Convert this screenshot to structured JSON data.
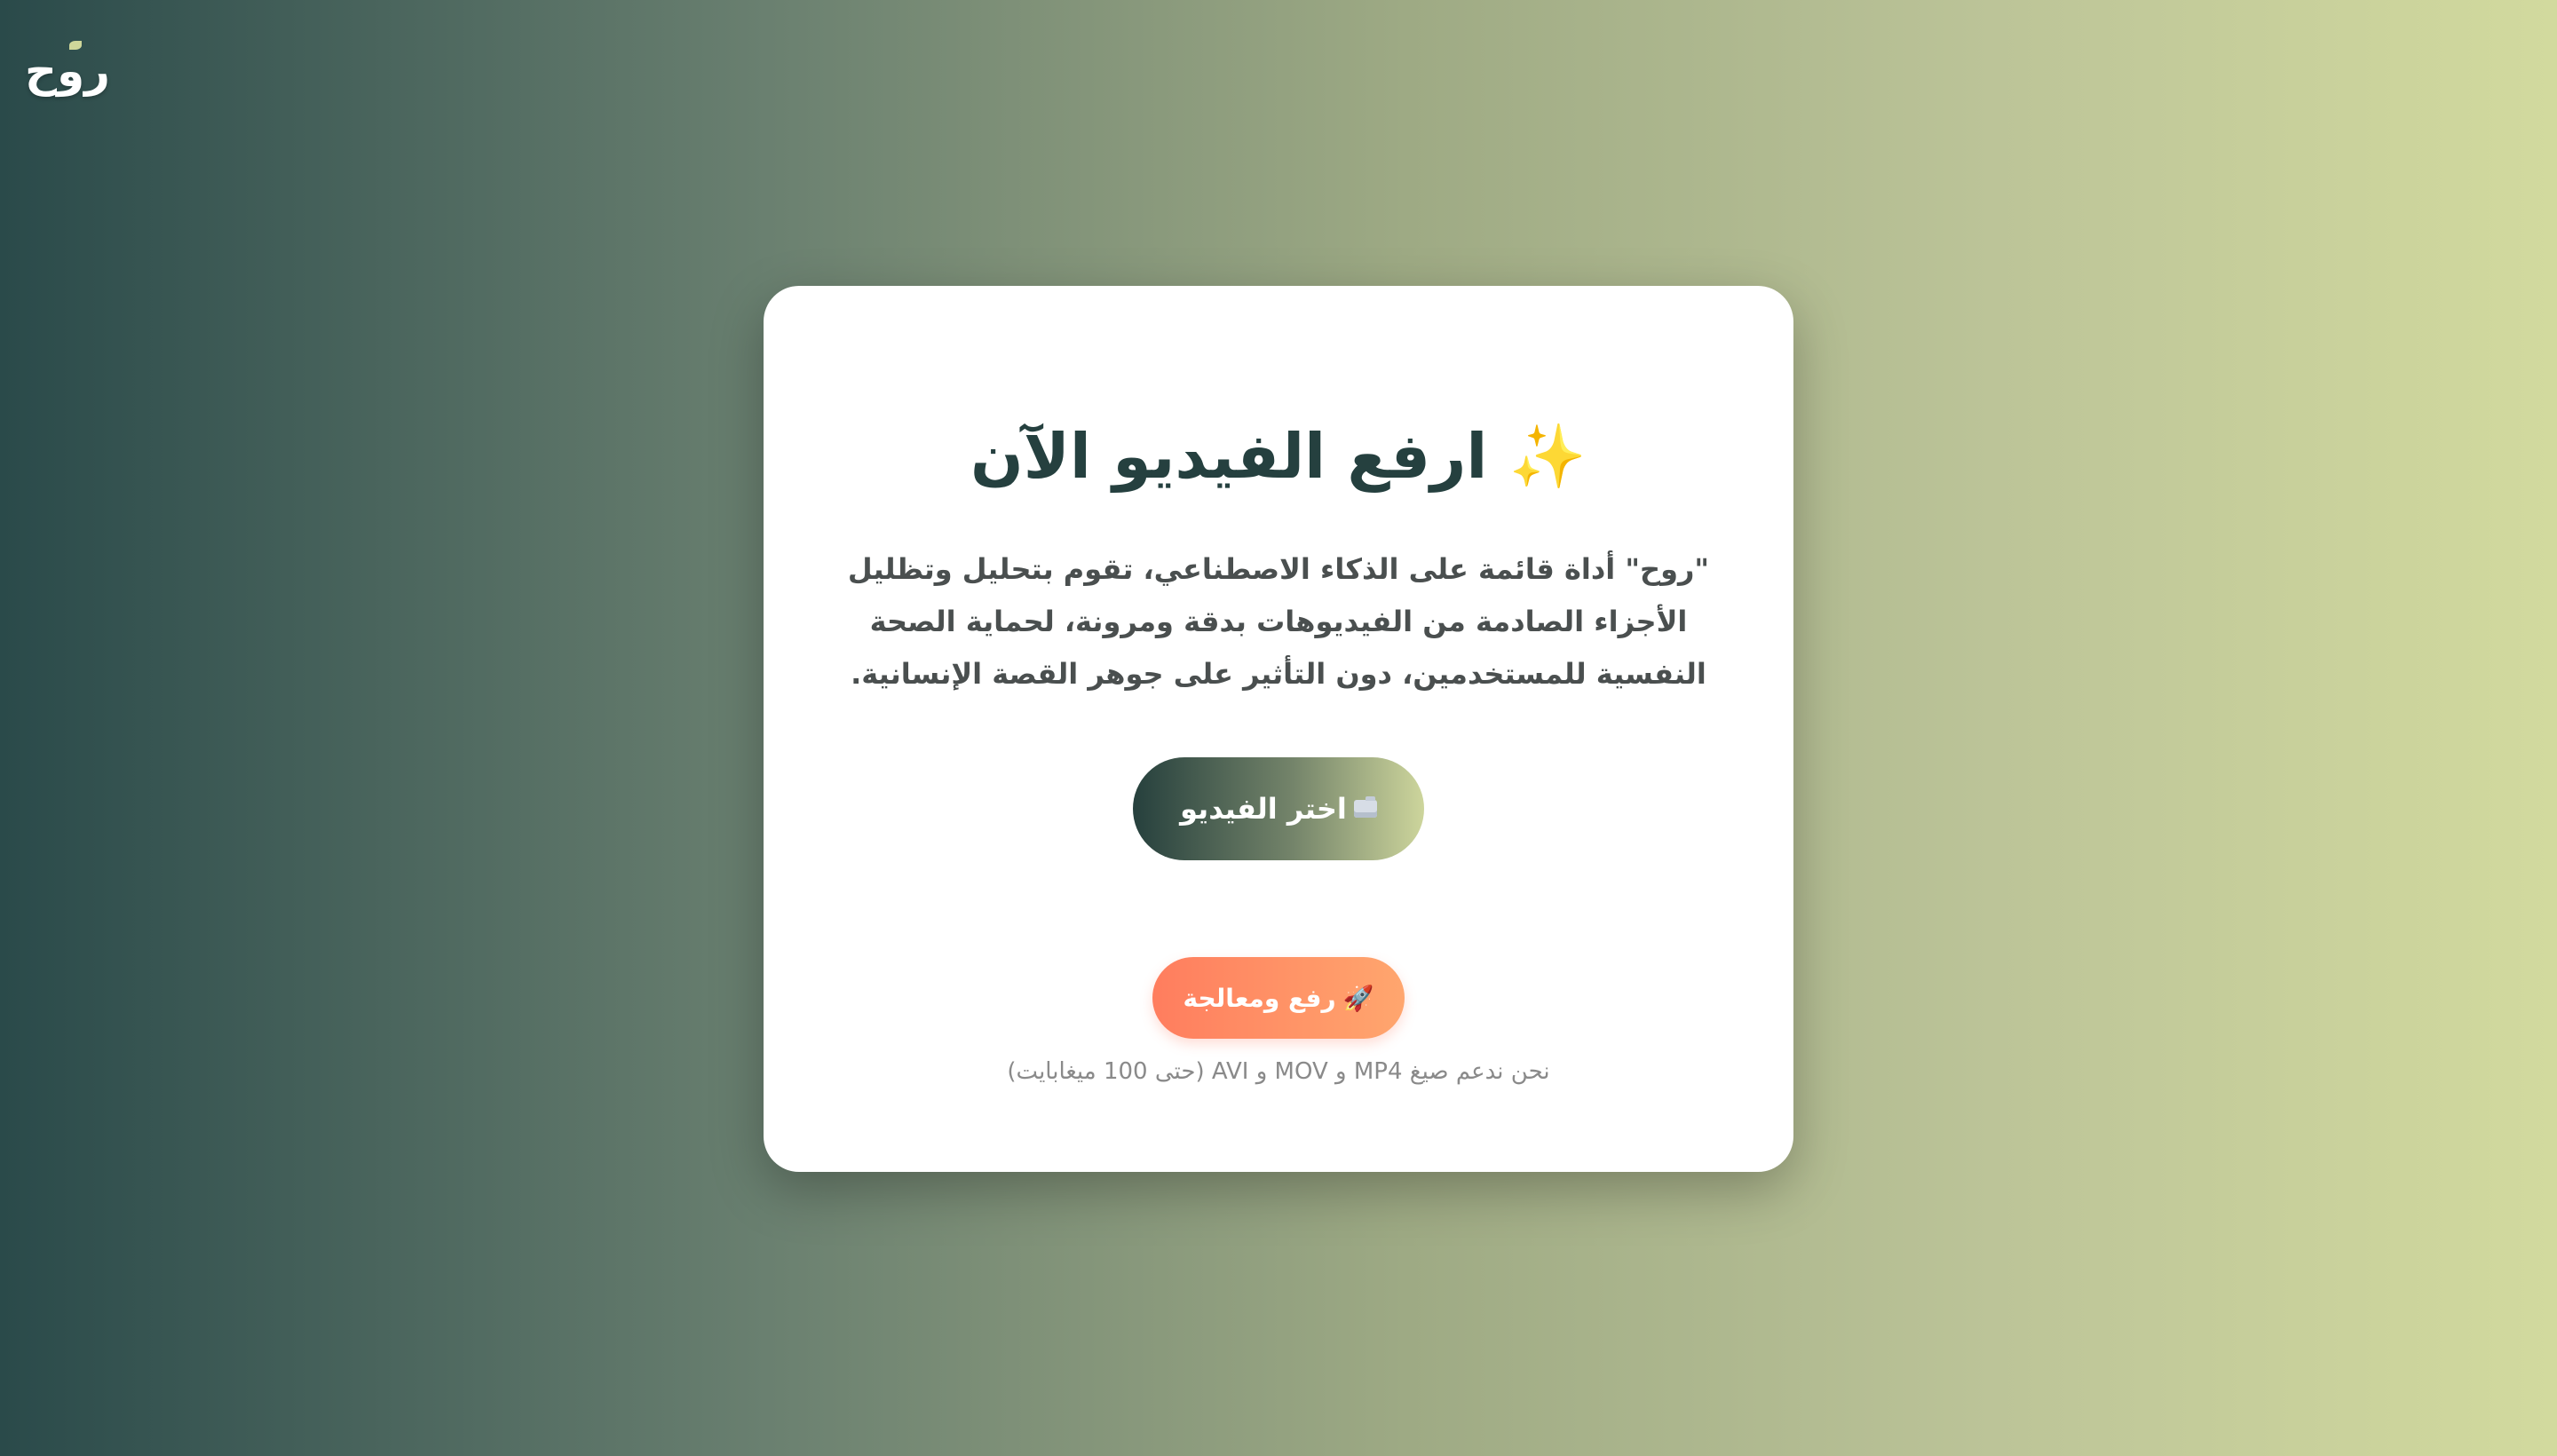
{
  "brand": {
    "logo_text": "روح"
  },
  "upload_card": {
    "title": "ارفع الفيديو الآن",
    "title_icon": "✨",
    "description": "\"روح\" أداة قائمة على الذكاء الاصطناعي، تقوم بتحليل وتظليل الأجزاء الصادمة من الفيديوهات بدقة ومرونة، لحماية الصحة النفسية للمستخدمين، دون التأثير على جوهر القصة الإنسانية.",
    "choose_button_label": "اختر الفيديو",
    "choose_button_icon": "folder-icon",
    "upload_button_label": "رفع ومعالجة",
    "upload_button_icon": "🚀",
    "supported_formats_note": "نحن ندعم صيغ MP4 و MOV و AVI (حتى 100 ميغابايت)"
  },
  "colors": {
    "title": "#25403f",
    "upload_button": "#ff7d5e",
    "background_start": "#2a4a4a",
    "background_end": "#d2da9e"
  }
}
